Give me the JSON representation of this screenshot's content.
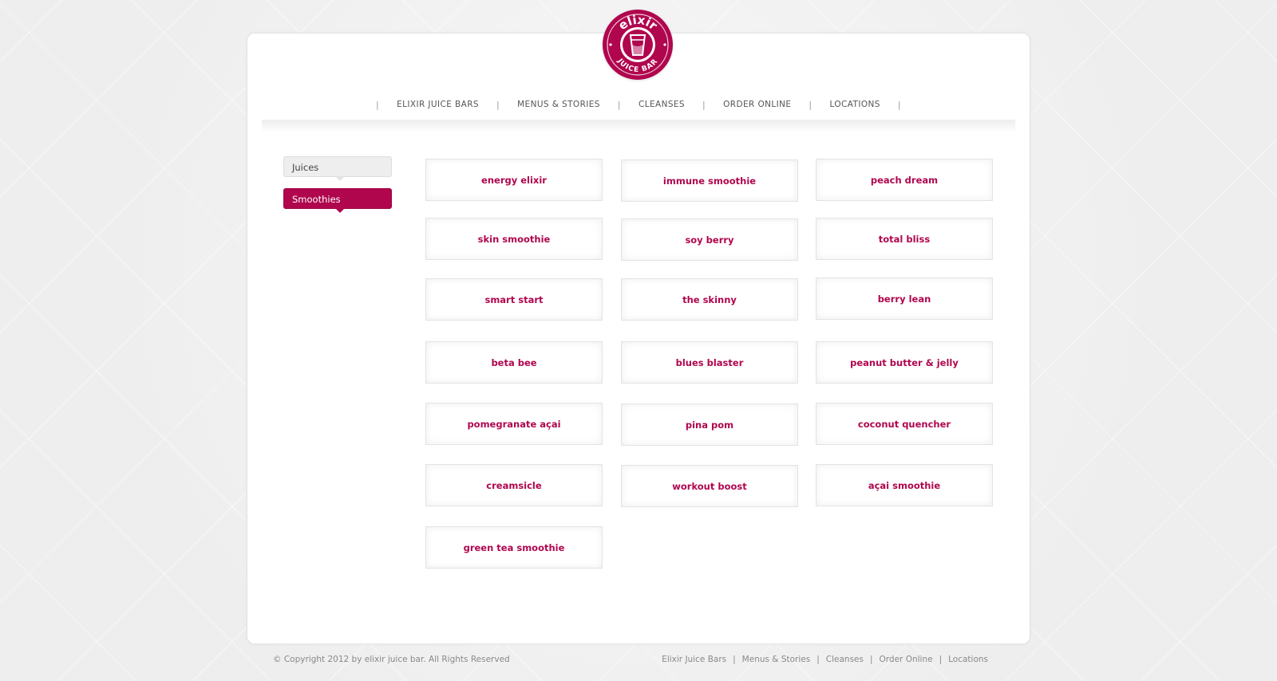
{
  "brand": {
    "logo_top_text": "elixir",
    "logo_bottom_text": "JUICE BAR",
    "accent_color": "#b0064e"
  },
  "nav": {
    "items": [
      {
        "label": "ELIXIR JUICE BARS"
      },
      {
        "label": "MENUS & STORIES"
      },
      {
        "label": "CLEANSES"
      },
      {
        "label": "ORDER ONLINE"
      },
      {
        "label": "LOCATIONS"
      }
    ]
  },
  "sidebar": {
    "tabs": [
      {
        "label": "Juices",
        "active": false
      },
      {
        "label": "Smoothies",
        "active": true
      }
    ]
  },
  "menu": {
    "items": [
      "energy elixir",
      "immune smoothie",
      "peach dream",
      "skin smoothie",
      "soy berry",
      "total bliss",
      "smart start",
      "the skinny",
      "berry lean",
      "beta bee",
      "blues blaster",
      "peanut butter & jelly",
      "pomegranate açai",
      "pina pom",
      "coconut quencher",
      "creamsicle",
      "workout boost",
      "açai smoothie",
      "green tea smoothie"
    ]
  },
  "footer": {
    "copyright": "© Copyright 2012 by elixir juice bar. All Rights Reserved",
    "links": [
      "Elixir Juice Bars",
      "Menus & Stories",
      "Cleanses",
      "Order Online",
      "Locations"
    ]
  }
}
